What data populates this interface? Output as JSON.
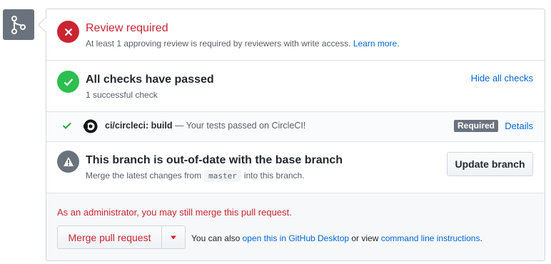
{
  "review": {
    "title": "Review required",
    "description": "At least 1 approving review is required by reviewers with write access.",
    "learn_more": "Learn more."
  },
  "checks": {
    "title": "All checks have passed",
    "summary": "1 successful check",
    "hide_all": "Hide all checks",
    "items": [
      {
        "name": "ci/circleci: build",
        "description": " — Your tests passed on CircleCI!",
        "badge": "Required",
        "details": "Details"
      }
    ]
  },
  "branch": {
    "title": "This branch is out-of-date with the base branch",
    "desc_before": "Merge the latest changes from",
    "base_branch": "master",
    "desc_after": "into this branch.",
    "update_button": "Update branch"
  },
  "merge": {
    "admin_note": "As an administrator, you may still merge this pull request.",
    "merge_button": "Merge pull request",
    "hint_prefix": "You can also ",
    "desktop_link": "open this in GitHub Desktop",
    "hint_middle": " or view ",
    "cli_link": "command line instructions",
    "hint_suffix": "."
  },
  "colors": {
    "error": "#cb2431",
    "success": "#2cbe4e",
    "neutral": "#6a737d",
    "link": "#0366d6"
  },
  "icons": {
    "merge": "git-merge-icon",
    "review": "x-circle-icon",
    "checks": "check-circle-icon",
    "branch": "alert-icon"
  }
}
